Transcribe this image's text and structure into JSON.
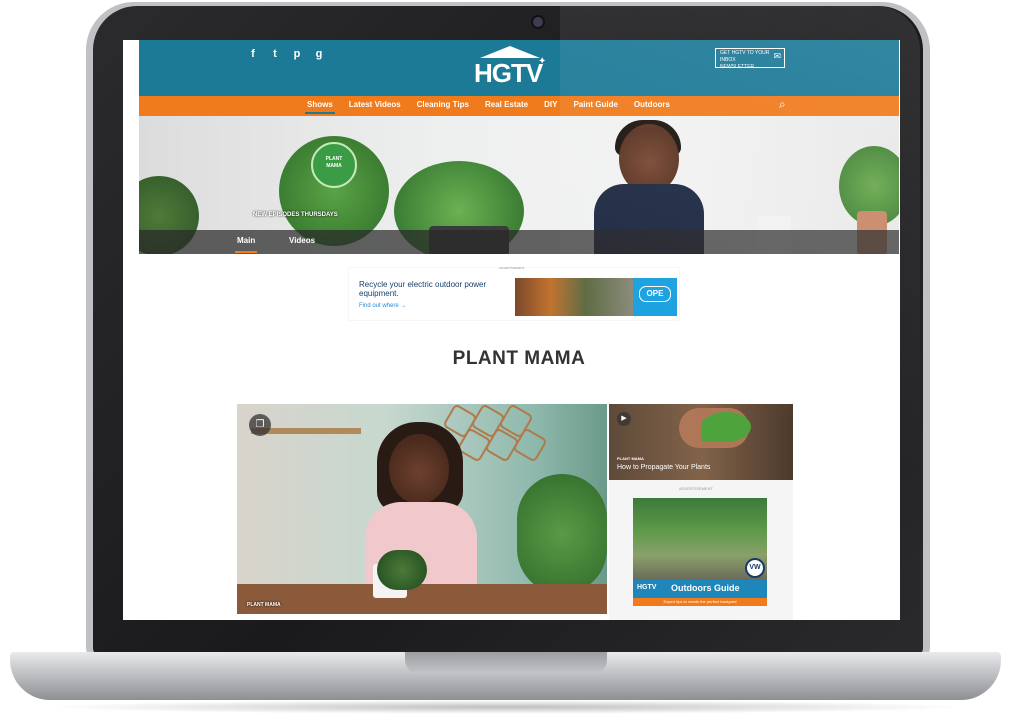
{
  "header": {
    "social_icons": [
      "f",
      "t",
      "p",
      "g"
    ],
    "social_icon_names": [
      "facebook-icon",
      "twitter-icon",
      "pinterest-icon",
      "instagram-icon"
    ],
    "logo_text": "HGTV",
    "newsletter_line1": "GET HGTV TO YOUR INBOX",
    "newsletter_line2": "NEWSLETTER"
  },
  "nav": {
    "items": [
      "Shows",
      "Latest Videos",
      "Cleaning Tips",
      "Real Estate",
      "DIY",
      "Paint Guide",
      "Outdoors"
    ],
    "active": "Shows",
    "search_icon": "search-icon"
  },
  "hero": {
    "badge_line1": "PLANT",
    "badge_line2": "MAMA",
    "caption": "NEW EPISODES THURSDAYS",
    "subnav": [
      "Main",
      "Videos"
    ],
    "subnav_active": "Main"
  },
  "ad_top": {
    "label": "ADVERTISEMENT",
    "text": "Recycle your electric outdoor power equipment.",
    "link": "Find out where →",
    "brand": "OPE"
  },
  "page_title": "PLANT MAMA",
  "main_card": {
    "caption": "PLANT MAMA",
    "icon": "gallery-icon"
  },
  "side_card": {
    "kicker": "PLANT MAMA",
    "title": "How to Propagate Your Plants",
    "icon": "play-icon"
  },
  "sidebar_ad": {
    "label": "ADVERTISEMENT",
    "logo": "HGTV",
    "title": "Outdoors Guide",
    "subtitle": "Expert tips to create the perfect backyard",
    "sponsor": "VW"
  },
  "colors": {
    "teal": "#1d7a97",
    "orange": "#f07b1c",
    "ope_blue": "#1aa1e0"
  }
}
